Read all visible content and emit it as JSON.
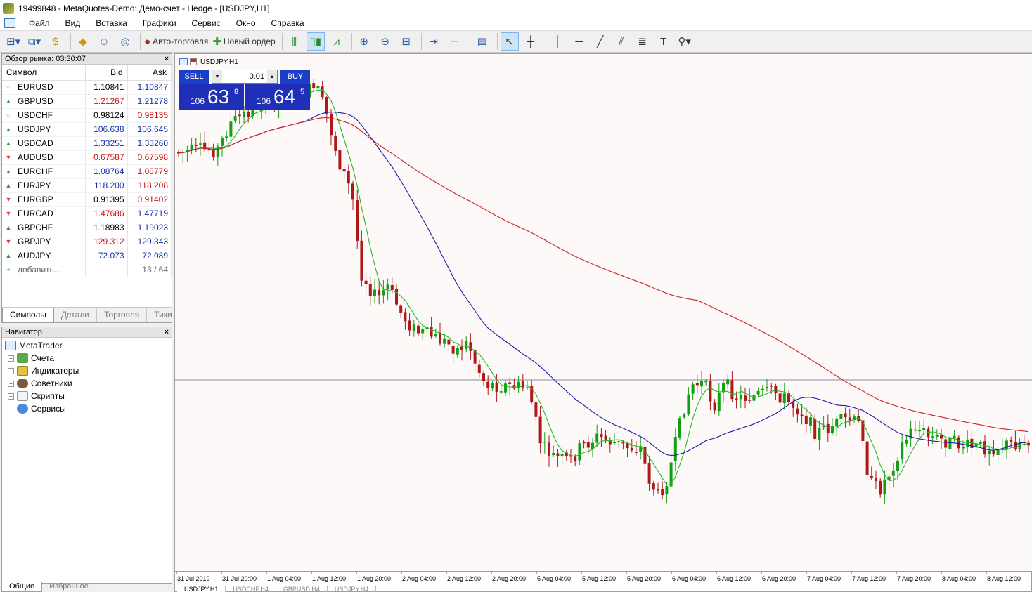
{
  "window": {
    "title": "19499848 - MetaQuotes-Demo: Демо-счет - Hedge - [USDJPY,H1]"
  },
  "menu": [
    "Файл",
    "Вид",
    "Вставка",
    "Графики",
    "Сервис",
    "Окно",
    "Справка"
  ],
  "toolbar": {
    "autotrade": "Авто-торговля",
    "new_order": "Новый ордер"
  },
  "market_watch": {
    "header": "Обзор рынка: 03:30:07",
    "columns": {
      "symbol": "Символ",
      "bid": "Bid",
      "ask": "Ask"
    },
    "rows": [
      {
        "symbol": "EURUSD",
        "dir": "flat",
        "bid": "1.10841",
        "ask": "1.10847",
        "bid_color": "black",
        "ask_color": "blue"
      },
      {
        "symbol": "GBPUSD",
        "dir": "up",
        "bid": "1.21267",
        "ask": "1.21278",
        "bid_color": "red",
        "ask_color": "blue"
      },
      {
        "symbol": "USDCHF",
        "dir": "flat",
        "bid": "0.98124",
        "ask": "0.98135",
        "bid_color": "black",
        "ask_color": "red"
      },
      {
        "symbol": "USDJPY",
        "dir": "up",
        "bid": "106.638",
        "ask": "106.645",
        "bid_color": "blue",
        "ask_color": "blue"
      },
      {
        "symbol": "USDCAD",
        "dir": "up",
        "bid": "1.33251",
        "ask": "1.33260",
        "bid_color": "blue",
        "ask_color": "blue"
      },
      {
        "symbol": "AUDUSD",
        "dir": "down",
        "bid": "0.67587",
        "ask": "0.67598",
        "bid_color": "red",
        "ask_color": "red"
      },
      {
        "symbol": "EURCHF",
        "dir": "up",
        "bid": "1.08764",
        "ask": "1.08779",
        "bid_color": "blue",
        "ask_color": "red"
      },
      {
        "symbol": "EURJPY",
        "dir": "up",
        "bid": "118.200",
        "ask": "118.208",
        "bid_color": "blue",
        "ask_color": "red"
      },
      {
        "symbol": "EURGBP",
        "dir": "down",
        "bid": "0.91395",
        "ask": "0.91402",
        "bid_color": "black",
        "ask_color": "red"
      },
      {
        "symbol": "EURCAD",
        "dir": "down",
        "bid": "1.47686",
        "ask": "1.47719",
        "bid_color": "red",
        "ask_color": "blue"
      },
      {
        "symbol": "GBPCHF",
        "dir": "up",
        "bid": "1.18983",
        "ask": "1.19023",
        "bid_color": "black",
        "ask_color": "blue"
      },
      {
        "symbol": "GBPJPY",
        "dir": "down",
        "bid": "129.312",
        "ask": "129.343",
        "bid_color": "red",
        "ask_color": "blue"
      },
      {
        "symbol": "AUDJPY",
        "dir": "up",
        "bid": "72.073",
        "ask": "72.089",
        "bid_color": "blue",
        "ask_color": "blue"
      }
    ],
    "add_label": "добавить...",
    "count": "13 / 64",
    "tabs": [
      "Символы",
      "Детали",
      "Торговля",
      "Тики"
    ]
  },
  "navigator": {
    "header": "Навигатор",
    "root": "MetaTrader",
    "items": [
      "Счета",
      "Индикаторы",
      "Советники",
      "Скрипты",
      "Сервисы"
    ],
    "tabs": [
      "Общие",
      "Избранное"
    ]
  },
  "chart": {
    "title": "USDJPY,H1",
    "oneclick": {
      "sell_label": "SELL",
      "buy_label": "BUY",
      "lot": "0.01",
      "sell_small": "106",
      "sell_big": "63",
      "sell_sup": "8",
      "buy_small": "106",
      "buy_big": "64",
      "buy_sup": "5"
    },
    "time_labels": [
      "31 Jul 2019",
      "31 Jul 20:00",
      "1 Aug 04:00",
      "1 Aug 12:00",
      "1 Aug 20:00",
      "2 Aug 04:00",
      "2 Aug 12:00",
      "2 Aug 20:00",
      "5 Aug 04:00",
      "5 Aug 12:00",
      "5 Aug 20:00",
      "6 Aug 04:00",
      "6 Aug 12:00",
      "6 Aug 20:00",
      "7 Aug 04:00",
      "7 Aug 12:00",
      "7 Aug 20:00",
      "8 Aug 04:00",
      "8 Aug 12:00"
    ],
    "colors": {
      "bull": "#12a012",
      "bear": "#b01818",
      "ma_fast": "#22bb22",
      "ma_mid": "#1a1aa8",
      "ma_slow": "#cc2222",
      "background": "#fdf9f9",
      "hline": "#8a8aa8"
    },
    "tabs": [
      "USDJPY,H1",
      "USDCHF,H4",
      "GBPUSD,H4",
      "USDJPY,H4"
    ]
  }
}
